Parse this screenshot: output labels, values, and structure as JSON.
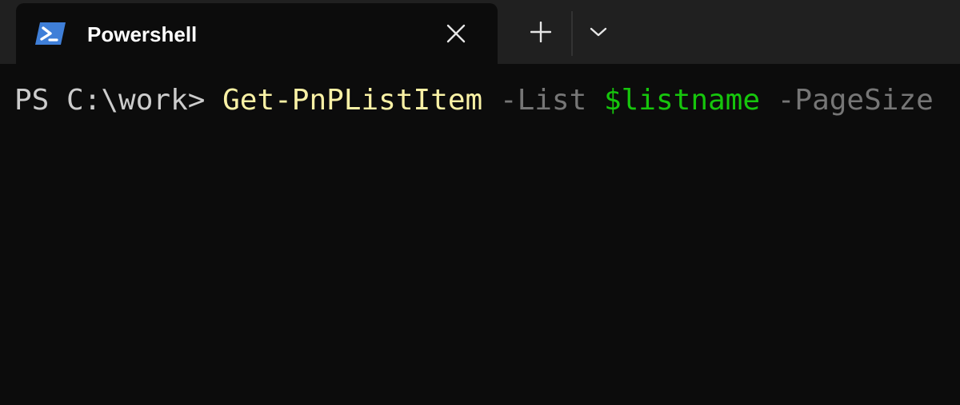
{
  "tab": {
    "title": "Powershell",
    "icon": "powershell-icon",
    "close_icon": "close-icon"
  },
  "toolbar": {
    "new_tab_icon": "plus-icon",
    "dropdown_icon": "chevron-down-icon"
  },
  "terminal": {
    "prompt": "PS C:\\work> ",
    "command": "Get-PnPListItem",
    "space1": " ",
    "param1": "-List",
    "space2": " ",
    "variable": "$listname",
    "space3": " ",
    "param2": "-PageSize"
  },
  "colors": {
    "tabbar_bg": "#202020",
    "terminal_bg": "#0c0c0c",
    "prompt": "#cccccc",
    "command": "#f9f1a5",
    "parameter": "#767676",
    "variable": "#16c60c",
    "powershell_blue": "#3f7fd8"
  }
}
